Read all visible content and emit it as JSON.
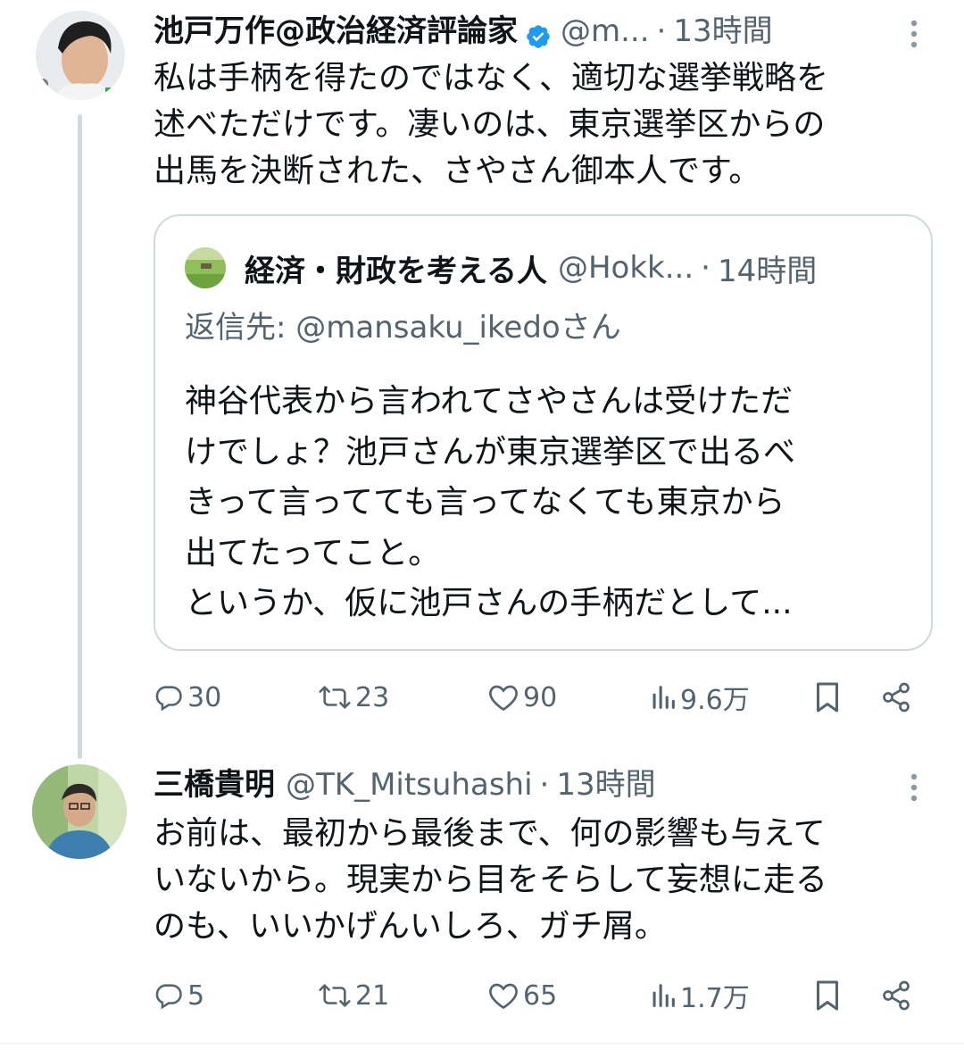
{
  "tweets": [
    {
      "author_name": "池戸万作@政治経済評論家",
      "author_handle": "@m...",
      "separator": "·",
      "time": "13時間",
      "verified": true,
      "text": "私は手柄を得たのではなく、適切な選挙戦略を\n述べただけです。凄いのは、東京選挙区からの\n出馬を決断された、さやさん御本人です。",
      "quote": {
        "author_name": "経済・財政を考える人",
        "author_handle": "@Hokk...",
        "separator": "·",
        "time": "14時間",
        "reply_prefix": "返信先: ",
        "reply_to": "@mansaku_ikedo",
        "reply_suffix": "さん",
        "text": "神谷代表から言われてさやさんは受けただ\nけでしょ？池戸さんが東京選挙区で出るべ\nきって言ってても言ってなくても東京から\n出てたってこと。\nというか、仮に池戸さんの手柄だとして..."
      },
      "stats": {
        "replies": "30",
        "retweets": "23",
        "likes": "90",
        "views": "9.6万"
      }
    },
    {
      "author_name": "三橋貴明",
      "author_handle": "@TK_Mitsuhashi",
      "separator": "·",
      "time": "13時間",
      "verified": false,
      "text": "お前は、最初から最後まで、何の影響も与えて\nいないから。現実から目をそらして妄想に走る\nのも、いいかげんいしろ、ガチ屑。",
      "stats": {
        "replies": "5",
        "retweets": "21",
        "likes": "65",
        "views": "1.7万"
      }
    }
  ],
  "icons": {
    "reply": "reply-icon",
    "retweet": "retweet-icon",
    "like": "heart-icon",
    "views": "views-icon",
    "bookmark": "bookmark-icon",
    "share": "share-icon",
    "more": "more-icon",
    "verified": "verified-badge-icon"
  },
  "colors": {
    "text": "#0f1419",
    "secondary": "#536471",
    "verified": "#1d9bf0",
    "border": "#cfd9de"
  }
}
